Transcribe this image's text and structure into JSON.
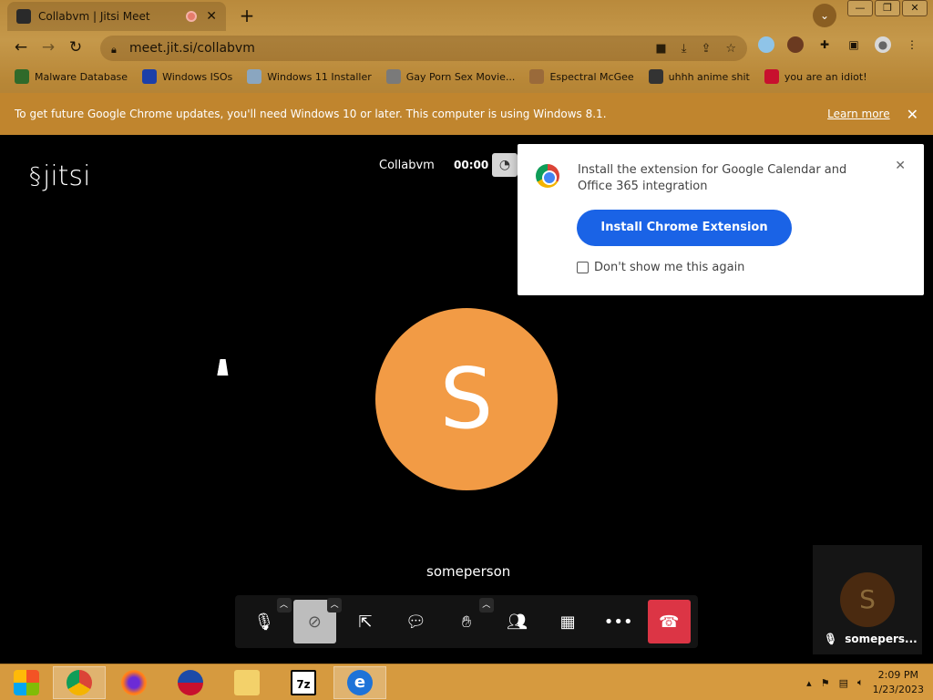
{
  "browser": {
    "tab_title": "Collabvm | Jitsi Meet",
    "url": "meet.jit.si/collabvm",
    "bookmarks": [
      "Malware Database",
      "Windows ISOs",
      "Windows 11 Installer",
      "Gay Porn Sex Movie...",
      "Espectral McGee",
      "uhhh anime shit",
      "you are an idiot!"
    ],
    "infobar": {
      "message": "To get future Google Chrome updates, you'll need Windows 10 or later. This computer is using Windows 8.1.",
      "learn_more": "Learn more"
    }
  },
  "meet": {
    "logo": "jitsi",
    "room_name": "Collabvm",
    "timer": "00:00",
    "popup": {
      "text": "Install the extension for Google Calendar and Office 365 integration",
      "button": "Install Chrome Extension",
      "checkbox_label": "Don't show me this again"
    },
    "participant_initial": "S",
    "participant_name": "someperson",
    "thumb_name": "somepers..."
  },
  "taskbar": {
    "time": "2:09 PM",
    "date": "1/23/2023"
  },
  "colors": {
    "avatar": "#f29b45",
    "hangup": "#dc3545",
    "install_button": "#1a63e6"
  }
}
